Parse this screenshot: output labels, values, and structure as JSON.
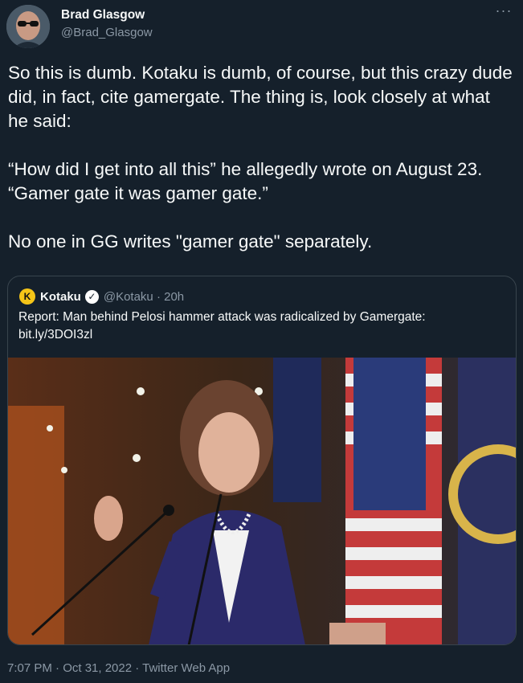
{
  "author": {
    "display_name": "Brad Glasgow",
    "handle": "@Brad_Glasgow"
  },
  "more_icon": "more-horizontal-icon",
  "more_label": "···",
  "tweet": {
    "paragraphs": [
      "So this is dumb. Kotaku is dumb, of course, but this crazy dude did, in fact, cite gamergate. The thing is, look closely at what he said:",
      "“How did I get into all this” he allegedly wrote on August 23. “Gamer gate it was gamer gate.”",
      "No one in GG writes \"gamer gate\" separately."
    ]
  },
  "quote": {
    "name": "Kotaku",
    "handle_time": "@Kotaku · 20h",
    "logo_glyph": "K",
    "verified_glyph": "✓",
    "text_line1": "Report: Man behind Pelosi hammer attack was radicalized by Gamergate:",
    "text_line2": "bit.ly/3DOI3zl"
  },
  "footer": {
    "timestamp": "7:07 PM · Oct 31, 2022 · Twitter Web App"
  },
  "colors": {
    "background": "#15202b",
    "text": "#f7f9f9",
    "secondary_text": "#8b98a5",
    "border": "#38444d",
    "kotaku_yellow": "#f5c518"
  }
}
